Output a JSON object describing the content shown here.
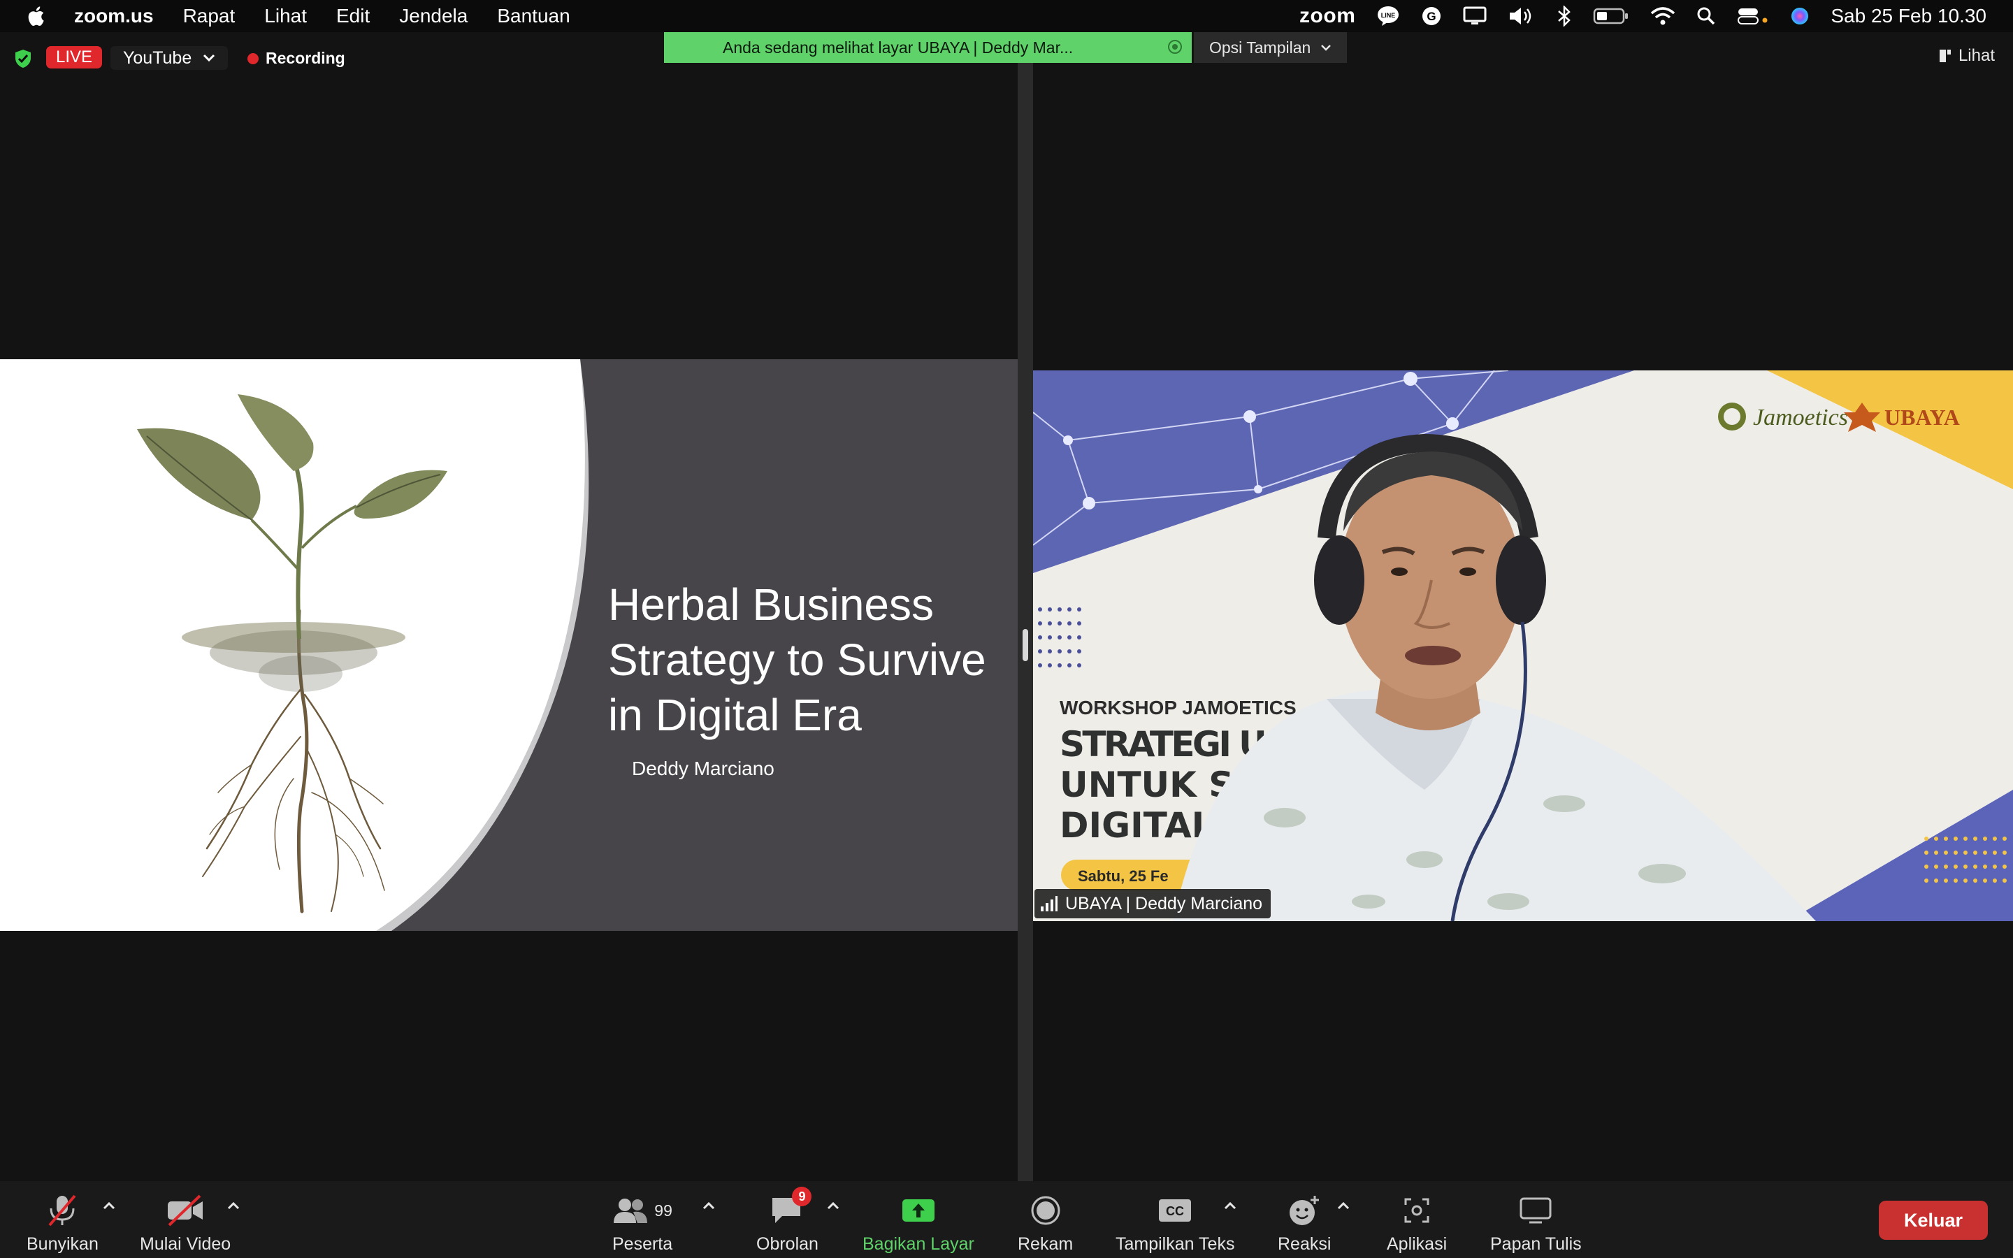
{
  "menubar": {
    "app_name": "zoom.us",
    "items": [
      "Rapat",
      "Lihat",
      "Edit",
      "Jendela",
      "Bantuan"
    ],
    "zoom_wordmark": "zoom",
    "clock": "Sab 25 Feb  10.30"
  },
  "top": {
    "live_label": "LIVE",
    "stream_target": "YouTube",
    "recording_label": "Recording",
    "share_banner": "Anda sedang melihat layar UBAYA | Deddy Mar...",
    "view_options": "Opsi Tampilan",
    "view_button": "Lihat"
  },
  "slide": {
    "title_line1": "Herbal Business",
    "title_line2": "Strategy to Survive",
    "title_line3": "in Digital Era",
    "subtitle": "Deddy Marciano"
  },
  "video": {
    "workshop_label": "WORKSHOP JAMOETICS",
    "banner_line1": "STRATEGI USAHA HE",
    "banner_line2": "UNTUK SURVIV",
    "banner_line3": "DIGITAL",
    "date_pill": "Sabtu, 25 Fe",
    "logo_jamoetics": "Jamoetics",
    "logo_ubaya": "UBAYA",
    "participant_name": "UBAYA | Deddy Marciano"
  },
  "toolbar": {
    "unmute": "Bunyikan",
    "start_video": "Mulai Video",
    "participants": "Peserta",
    "participant_count": "99",
    "chat": "Obrolan",
    "chat_badge": "9",
    "share": "Bagikan Layar",
    "record": "Rekam",
    "captions": "Tampilkan Teks",
    "captions_icon_text": "CC",
    "reactions": "Reaksi",
    "apps": "Aplikasi",
    "whiteboard": "Papan Tulis",
    "leave": "Keluar"
  },
  "colors": {
    "live_red": "#e0272c",
    "share_green": "#5fd36a",
    "leave_red": "#c8312f",
    "slide_grey": "#474549",
    "banner_blue": "#5b64b8",
    "banner_yellow": "#f4c545"
  }
}
